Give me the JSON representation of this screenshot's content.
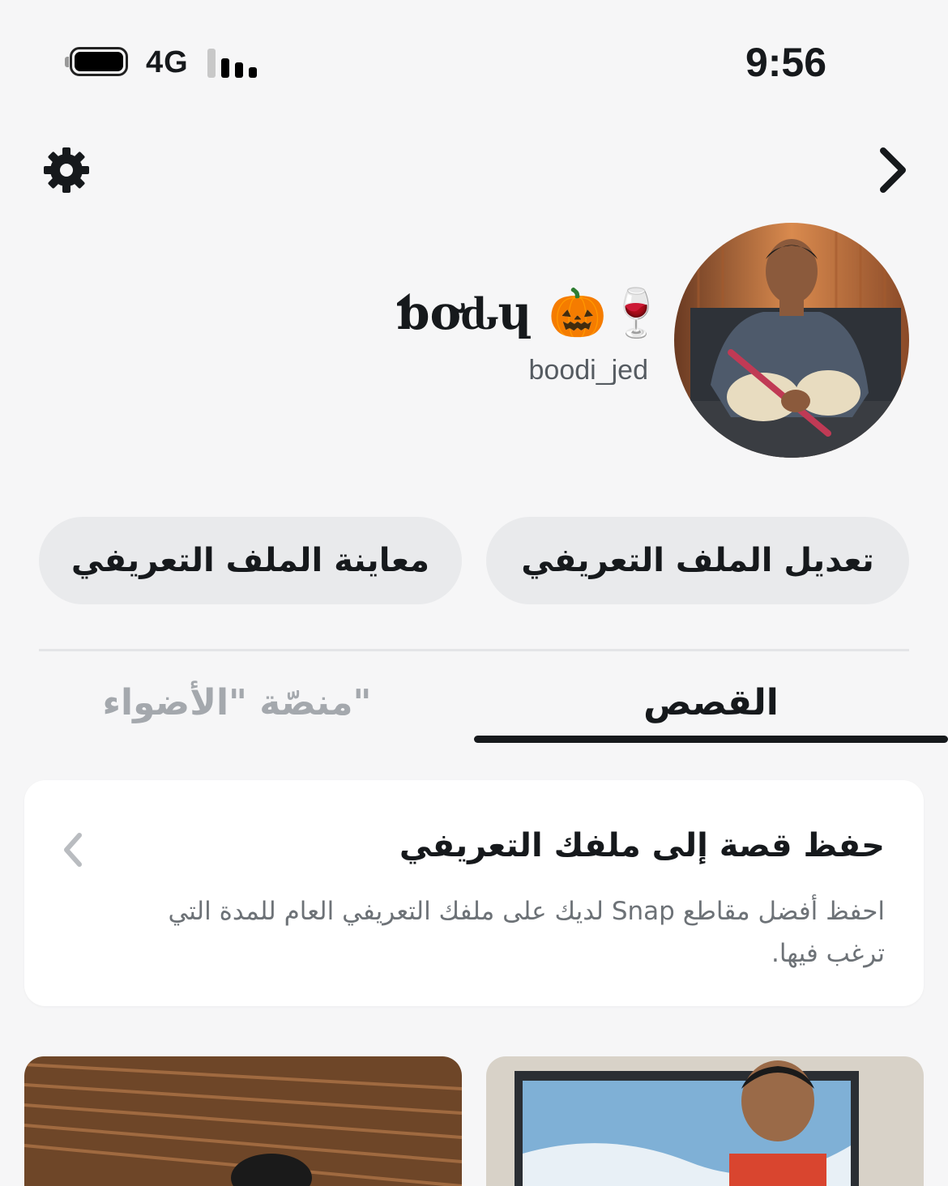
{
  "status_bar": {
    "time": "9:56",
    "network": "4G",
    "icons": [
      "battery-icon",
      "signal-bars-icon"
    ]
  },
  "header": {
    "icons": [
      "settings-gear-icon",
      "chevron-right-icon"
    ]
  },
  "profile": {
    "display_name": "ƅơԃɥ 🎃🍷",
    "username": "boodi_jed"
  },
  "buttons": {
    "edit_profile": "تعديل الملف التعريفي",
    "preview_profile": "معاينة الملف التعريفي"
  },
  "tabs": {
    "stories": "القصص",
    "spotlight": "منصّة \"الأضواء\"",
    "active": "stories"
  },
  "save_story_card": {
    "title": "حفظ قصة إلى ملفك التعريفي",
    "description": "احفظ أفضل مقاطع Snap لديك على ملفك التعريفي العام للمدة التي ترغب فيها."
  },
  "colors": {
    "background": "#f6f6f7",
    "button_bg": "#e9eaec",
    "text_primary": "#16191c",
    "text_secondary": "#6d7277",
    "tab_inactive": "#a4a8ad"
  }
}
